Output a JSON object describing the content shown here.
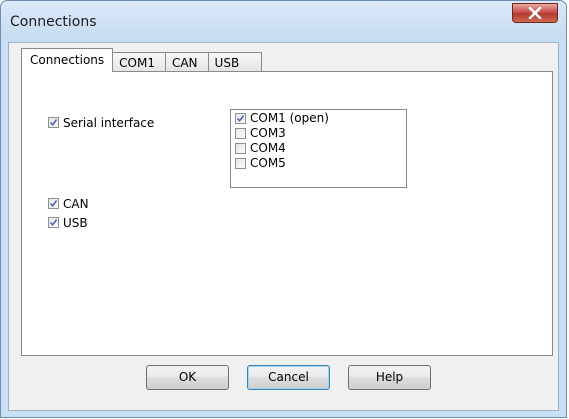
{
  "window": {
    "title": "Connections"
  },
  "tabs": [
    {
      "label": "Connections"
    },
    {
      "label": "COM1"
    },
    {
      "label": "CAN"
    },
    {
      "label": "USB"
    }
  ],
  "options": {
    "serial": {
      "label": "Serial interface",
      "checked": true
    },
    "can": {
      "label": "CAN",
      "checked": true
    },
    "usb": {
      "label": "USB",
      "checked": true
    }
  },
  "ports": [
    {
      "label": "COM1 (open)",
      "checked": true
    },
    {
      "label": "COM3",
      "checked": false
    },
    {
      "label": "COM4",
      "checked": false
    },
    {
      "label": "COM5",
      "checked": false
    }
  ],
  "buttons": {
    "ok": "OK",
    "cancel": "Cancel",
    "help": "Help"
  }
}
